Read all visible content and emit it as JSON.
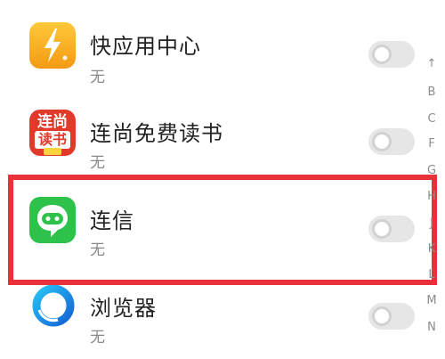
{
  "apps": [
    {
      "name": "快应用中心",
      "subtitle": "无",
      "icon": "quick-app-center-bolt-icon",
      "enabled": false
    },
    {
      "name": "连尚免费读书",
      "subtitle": "无",
      "icon": "lianshang-reading-icon",
      "icon_text_top": "连尚",
      "icon_text_bottom": "读书",
      "enabled": false
    },
    {
      "name": "连信",
      "subtitle": "无",
      "icon": "lianxin-chat-bubble-icon",
      "enabled": false,
      "highlighted": true
    },
    {
      "name": "浏览器",
      "subtitle": "无",
      "icon": "browser-ring-icon",
      "enabled": false
    }
  ],
  "index_bar": [
    "↑",
    "B",
    "C",
    "F",
    "G",
    "H",
    "J",
    "K",
    "L",
    "M",
    "N"
  ],
  "colors": {
    "highlight": "#e8313b",
    "toggle_off": "#e6e6e6",
    "quick_app_orange": "#f5a623",
    "lianshang_red": "#e23a2a",
    "lianxin_green": "#2fc24a",
    "browser_blue": "#1e90e8"
  }
}
